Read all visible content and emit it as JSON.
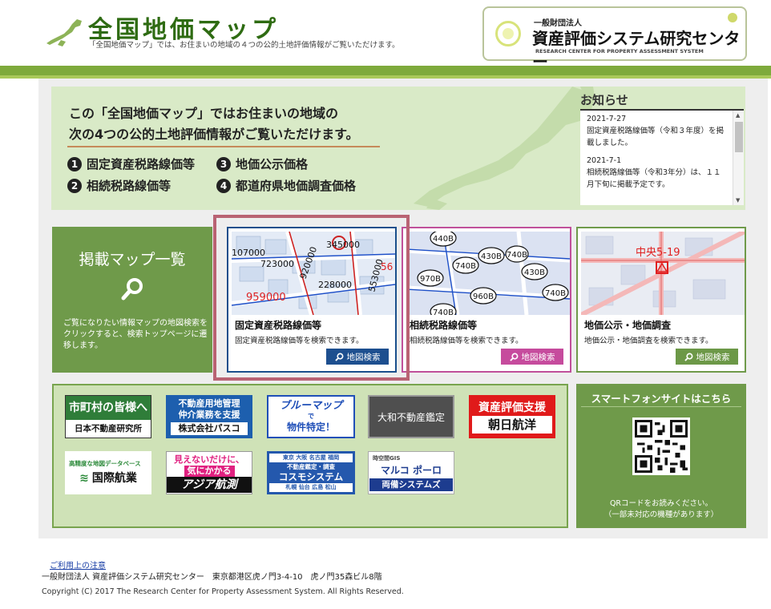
{
  "header": {
    "title": "全国地価マップ",
    "subtitle": "「全国地価マップ」では、お住まいの地域の４つの公的土地評価情報がご覧いただけます。",
    "org_small": "一般財団法人",
    "org_name": "資産評価システム研究センター",
    "org_en": "RESEARCH CENTER FOR PROPERTY ASSESSMENT SYSTEM"
  },
  "hero": {
    "line1": "この「全国地価マップ」ではお住まいの地域の",
    "line2": "次の4つの公的土地評価情報がご覧いただけます。",
    "items": [
      {
        "num": "1",
        "label": "固定資産税路線価等"
      },
      {
        "num": "2",
        "label": "相続税路線価等"
      },
      {
        "num": "3",
        "label": "地価公示価格"
      },
      {
        "num": "4",
        "label": "都道府県地価調査価格"
      }
    ]
  },
  "news": {
    "title": "お知らせ",
    "items": [
      {
        "date": "2021-7-27",
        "text": "固定資産税路線価等（令和３年度）を掲載しました。"
      },
      {
        "date": "2021-7-1",
        "text": "相続税路線価等（令和3年分）は、１１月下旬に掲載予定です。"
      }
    ]
  },
  "maplist": {
    "title": "掲載マップ一覧",
    "desc": "ご覧になりたい情報マップの地図検索をクリックすると、検索トップページに遷移します。"
  },
  "cards": [
    {
      "title": "固定資産税路線価等",
      "desc": "固定資産税路線価等を検索できます。",
      "button": "地図検索"
    },
    {
      "title": "相続税路線価等",
      "desc": "相続税路線価等を検索できます。",
      "button": "地図検索"
    },
    {
      "title": "地価公示・地価調査",
      "desc": "地価公示・地価調査を検索できます。",
      "button": "地図検索"
    }
  ],
  "map_labels": {
    "fixed": [
      "345000",
      "920000",
      "228000",
      "553000",
      "959000",
      "107000",
      "723000",
      "56"
    ],
    "inherit": [
      "440B",
      "430B",
      "740B",
      "740B",
      "430B",
      "970B",
      "960B",
      "740B",
      "740B"
    ],
    "public": "中央5-19"
  },
  "ads": {
    "a1_top": "市町村の皆様へ",
    "a1_bottom": "日本不動産研究所",
    "a2_l1": "不動産用地管理",
    "a2_l2": "仲介業務を支援",
    "a2_l3": "株式会社パスコ",
    "a3_l1": "ブルーマップ",
    "a3_l2": "で",
    "a3_l3": "物件特定！",
    "a4": "大和不動産鑑定",
    "a5_top": "資産評価支援",
    "a5_bottom": "朝日航洋",
    "a6_top": "高精度な地図データベース",
    "a6_bottom": "国際航業",
    "a7_l1": "見えないだけに、",
    "a7_l2": "気にかかる",
    "a7_l3": "アジア航測",
    "a8_l1": "東京 大阪 名古屋 福岡",
    "a8_l2": "不動産鑑定・調査",
    "a8_l3": "コスモシステム",
    "a8_l4": "札幌 仙台 広島 松山",
    "a9_l1": "時空間GIS",
    "a9_l2": "マルコ ポーロ",
    "a9_l3": "両備システムズ"
  },
  "smartphone": {
    "title": "スマートフォンサイトはこちら",
    "note1": "QRコードをお読みください。",
    "note2": "（一部未対応の機種があります）"
  },
  "footer": {
    "link": "ご利用上の注意",
    "address": "一般財団法人 資産評価システム研究センター　東京都港区虎ノ門3-4-10　虎ノ門35森ビル8階",
    "copyright": "Copyright (C) 2017 The Research Center for Property Assessment System. All Rights Reserved."
  }
}
